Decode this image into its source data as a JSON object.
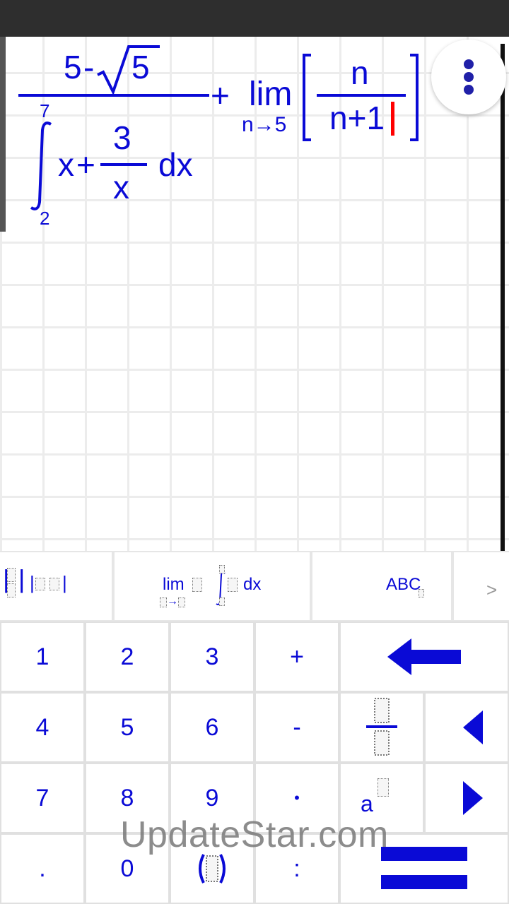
{
  "expression": {
    "numerator_int": "5",
    "minus": "-",
    "sqrt_arg": "5",
    "int_upper": "7",
    "int_lower": "2",
    "integrand_x": "x",
    "integrand_plus": "+",
    "frac_num": "3",
    "frac_den": "x",
    "dx": "dx",
    "plus": "+",
    "lim": "lim",
    "lim_sub": "n→5",
    "bracket_num": "n",
    "bracket_den": "n+1"
  },
  "template_tabs": {
    "abs_matrix_label": "|",
    "abs_label": "|",
    "calculus_lim": "lim",
    "calculus_sub_arrow": "→",
    "calculus_dx": "dx",
    "abc_label": "ABC",
    "next_label": ">"
  },
  "keypad": {
    "k1": "1",
    "k2": "2",
    "k3": "3",
    "kplus": "+",
    "k4": "4",
    "k5": "5",
    "k6": "6",
    "kminus": "-",
    "k7": "7",
    "k8": "8",
    "k9": "9",
    "kdot_mid": "•",
    "kperiod": ".",
    "k0": "0",
    "kcolon": ":",
    "power_base": "a"
  },
  "watermark": "UpdateStar.com",
  "colors": {
    "accent": "#0a0ad6",
    "cursor": "#ff0000",
    "status_bar": "#2e2e2e",
    "grid_line": "#ececec",
    "key_gap": "#e0e0e0"
  },
  "icons": {
    "menu": "more-vert-icon",
    "backspace": "backspace-arrow-icon",
    "fraction": "fraction-icon",
    "move_left": "triangle-left-icon",
    "move_right": "triangle-right-icon",
    "enter": "equals-enter-icon"
  }
}
